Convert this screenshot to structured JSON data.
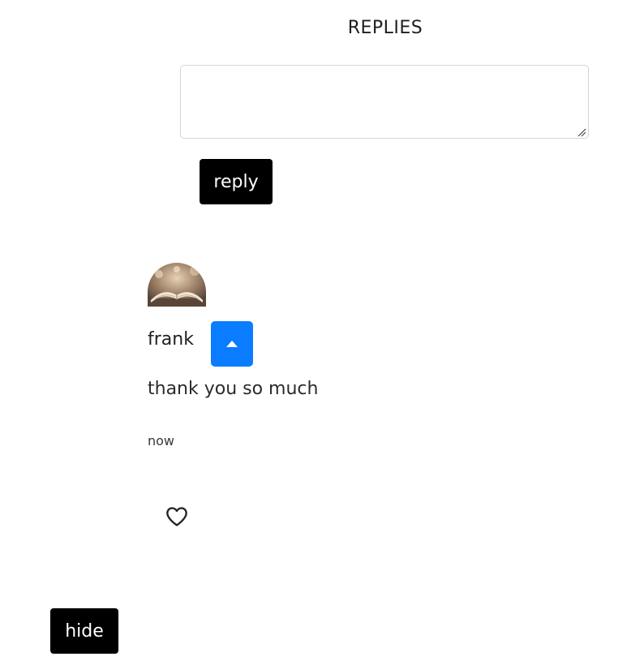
{
  "replies": {
    "title": "REPLIES",
    "input": {
      "value": "",
      "placeholder": ""
    },
    "submit_label": "reply"
  },
  "comment": {
    "avatar_icon": "open-book-photo",
    "author": "frank",
    "toggle_icon": "caret-up-icon",
    "text": "thank you so much",
    "time": "now",
    "like_icon": "heart-outline-icon"
  },
  "hide_label": "hide",
  "colors": {
    "toggle": "#0a7cff",
    "button": "#000000"
  }
}
